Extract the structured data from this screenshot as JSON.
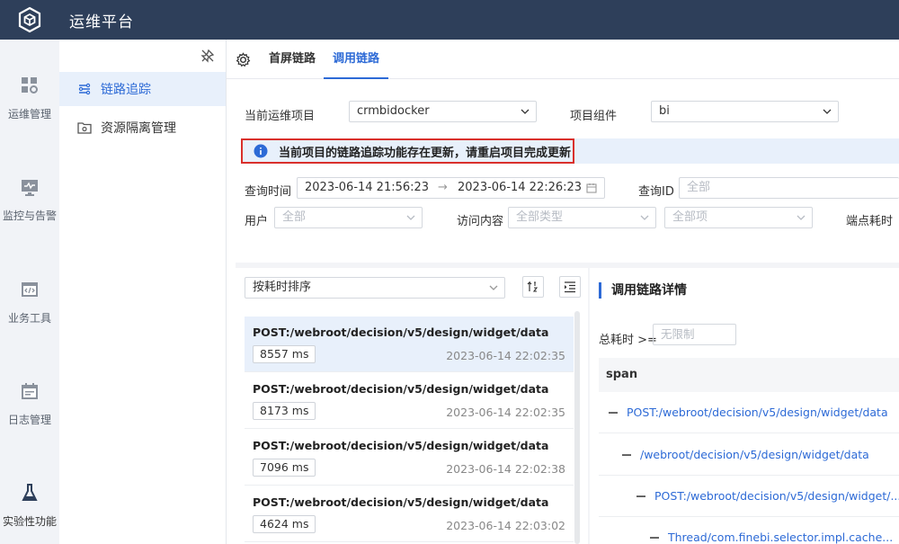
{
  "app": {
    "title": "运维平台"
  },
  "rail": [
    {
      "label": "运维管理",
      "icon": "dashboard-icon"
    },
    {
      "label": "监控与告警",
      "icon": "monitor-icon"
    },
    {
      "label": "业务工具",
      "icon": "code-window-icon"
    },
    {
      "label": "日志管理",
      "icon": "calendar-log-icon"
    },
    {
      "label": "实验性功能",
      "icon": "flask-icon"
    }
  ],
  "subnav": {
    "items": [
      {
        "label": "链路追踪",
        "active": true,
        "icon": "trace-icon"
      },
      {
        "label": "资源隔离管理",
        "active": false,
        "icon": "folder-settings-icon"
      }
    ]
  },
  "tabs": [
    {
      "label": "首屏链路",
      "active": false
    },
    {
      "label": "调用链路",
      "active": true
    }
  ],
  "filters": {
    "project_label": "当前运维项目",
    "project_value": "crmbidocker",
    "component_label": "项目组件",
    "component_value": "bi",
    "notice": "当前项目的链路追踪功能存在更新，请重启项目完成更新",
    "time_label": "查询时间",
    "time_start": "2023-06-14 21:56:23",
    "time_arrow": "→",
    "time_end": "2023-06-14 22:26:23",
    "query_id_label": "查询ID",
    "query_id_placeholder": "全部",
    "user_label": "用户",
    "user_placeholder": "全部",
    "access_label": "访问内容",
    "access_type_placeholder": "全部类型",
    "access_item_placeholder": "全部项",
    "endpoint_label": "端点耗时"
  },
  "list": {
    "sort_value": "按耗时排序",
    "items": [
      {
        "path": "POST:/webroot/decision/v5/design/widget/data",
        "duration": "8557 ms",
        "time": "2023-06-14 22:02:35",
        "selected": true
      },
      {
        "path": "POST:/webroot/decision/v5/design/widget/data",
        "duration": "8173 ms",
        "time": "2023-06-14 22:02:35",
        "selected": false
      },
      {
        "path": "POST:/webroot/decision/v5/design/widget/data",
        "duration": "7096 ms",
        "time": "2023-06-14 22:02:38",
        "selected": false
      },
      {
        "path": "POST:/webroot/decision/v5/design/widget/data",
        "duration": "4624 ms",
        "time": "2023-06-14 22:03:02",
        "selected": false
      }
    ]
  },
  "detail": {
    "title": "调用链路详情",
    "total_label": "总耗时 >=",
    "total_placeholder": "无限制",
    "span_header": "span",
    "spans": [
      {
        "label": "POST:/webroot/decision/v5/design/widget/data",
        "depth": 0
      },
      {
        "label": "/webroot/decision/v5/design/widget/data",
        "depth": 1
      },
      {
        "label": "POST:/webroot/decision/v5/design/widget/...",
        "depth": 2
      },
      {
        "label": "Thread/com.finebi.selector.impl.cache...",
        "depth": 3
      }
    ]
  },
  "colors": {
    "topbar": "#2e3f5a",
    "accent": "#2d6ad6",
    "notice_border": "#d9302c"
  }
}
